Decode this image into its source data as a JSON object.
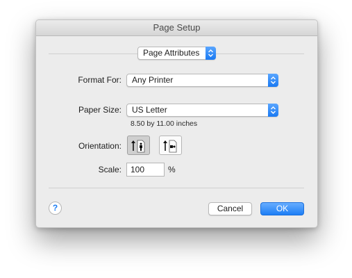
{
  "window": {
    "title": "Page Setup"
  },
  "panel_selector": {
    "value": "Page Attributes"
  },
  "format_for": {
    "label": "Format For:",
    "value": "Any Printer"
  },
  "paper_size": {
    "label": "Paper Size:",
    "value": "US Letter",
    "dimensions": "8.50 by 11.00 inches"
  },
  "orientation": {
    "label": "Orientation:",
    "options": [
      {
        "name": "portrait",
        "selected": true
      },
      {
        "name": "landscape",
        "selected": false
      }
    ]
  },
  "scale": {
    "label": "Scale:",
    "value": "100",
    "unit": "%"
  },
  "footer": {
    "help_label": "?",
    "cancel_label": "Cancel",
    "ok_label": "OK"
  },
  "colors": {
    "accent": "#1d7ef5",
    "dialog_bg": "#ececec"
  },
  "icons": {
    "popup": "chevron-up-down-icon",
    "portrait": "portrait-orientation-icon",
    "landscape": "landscape-orientation-icon"
  }
}
